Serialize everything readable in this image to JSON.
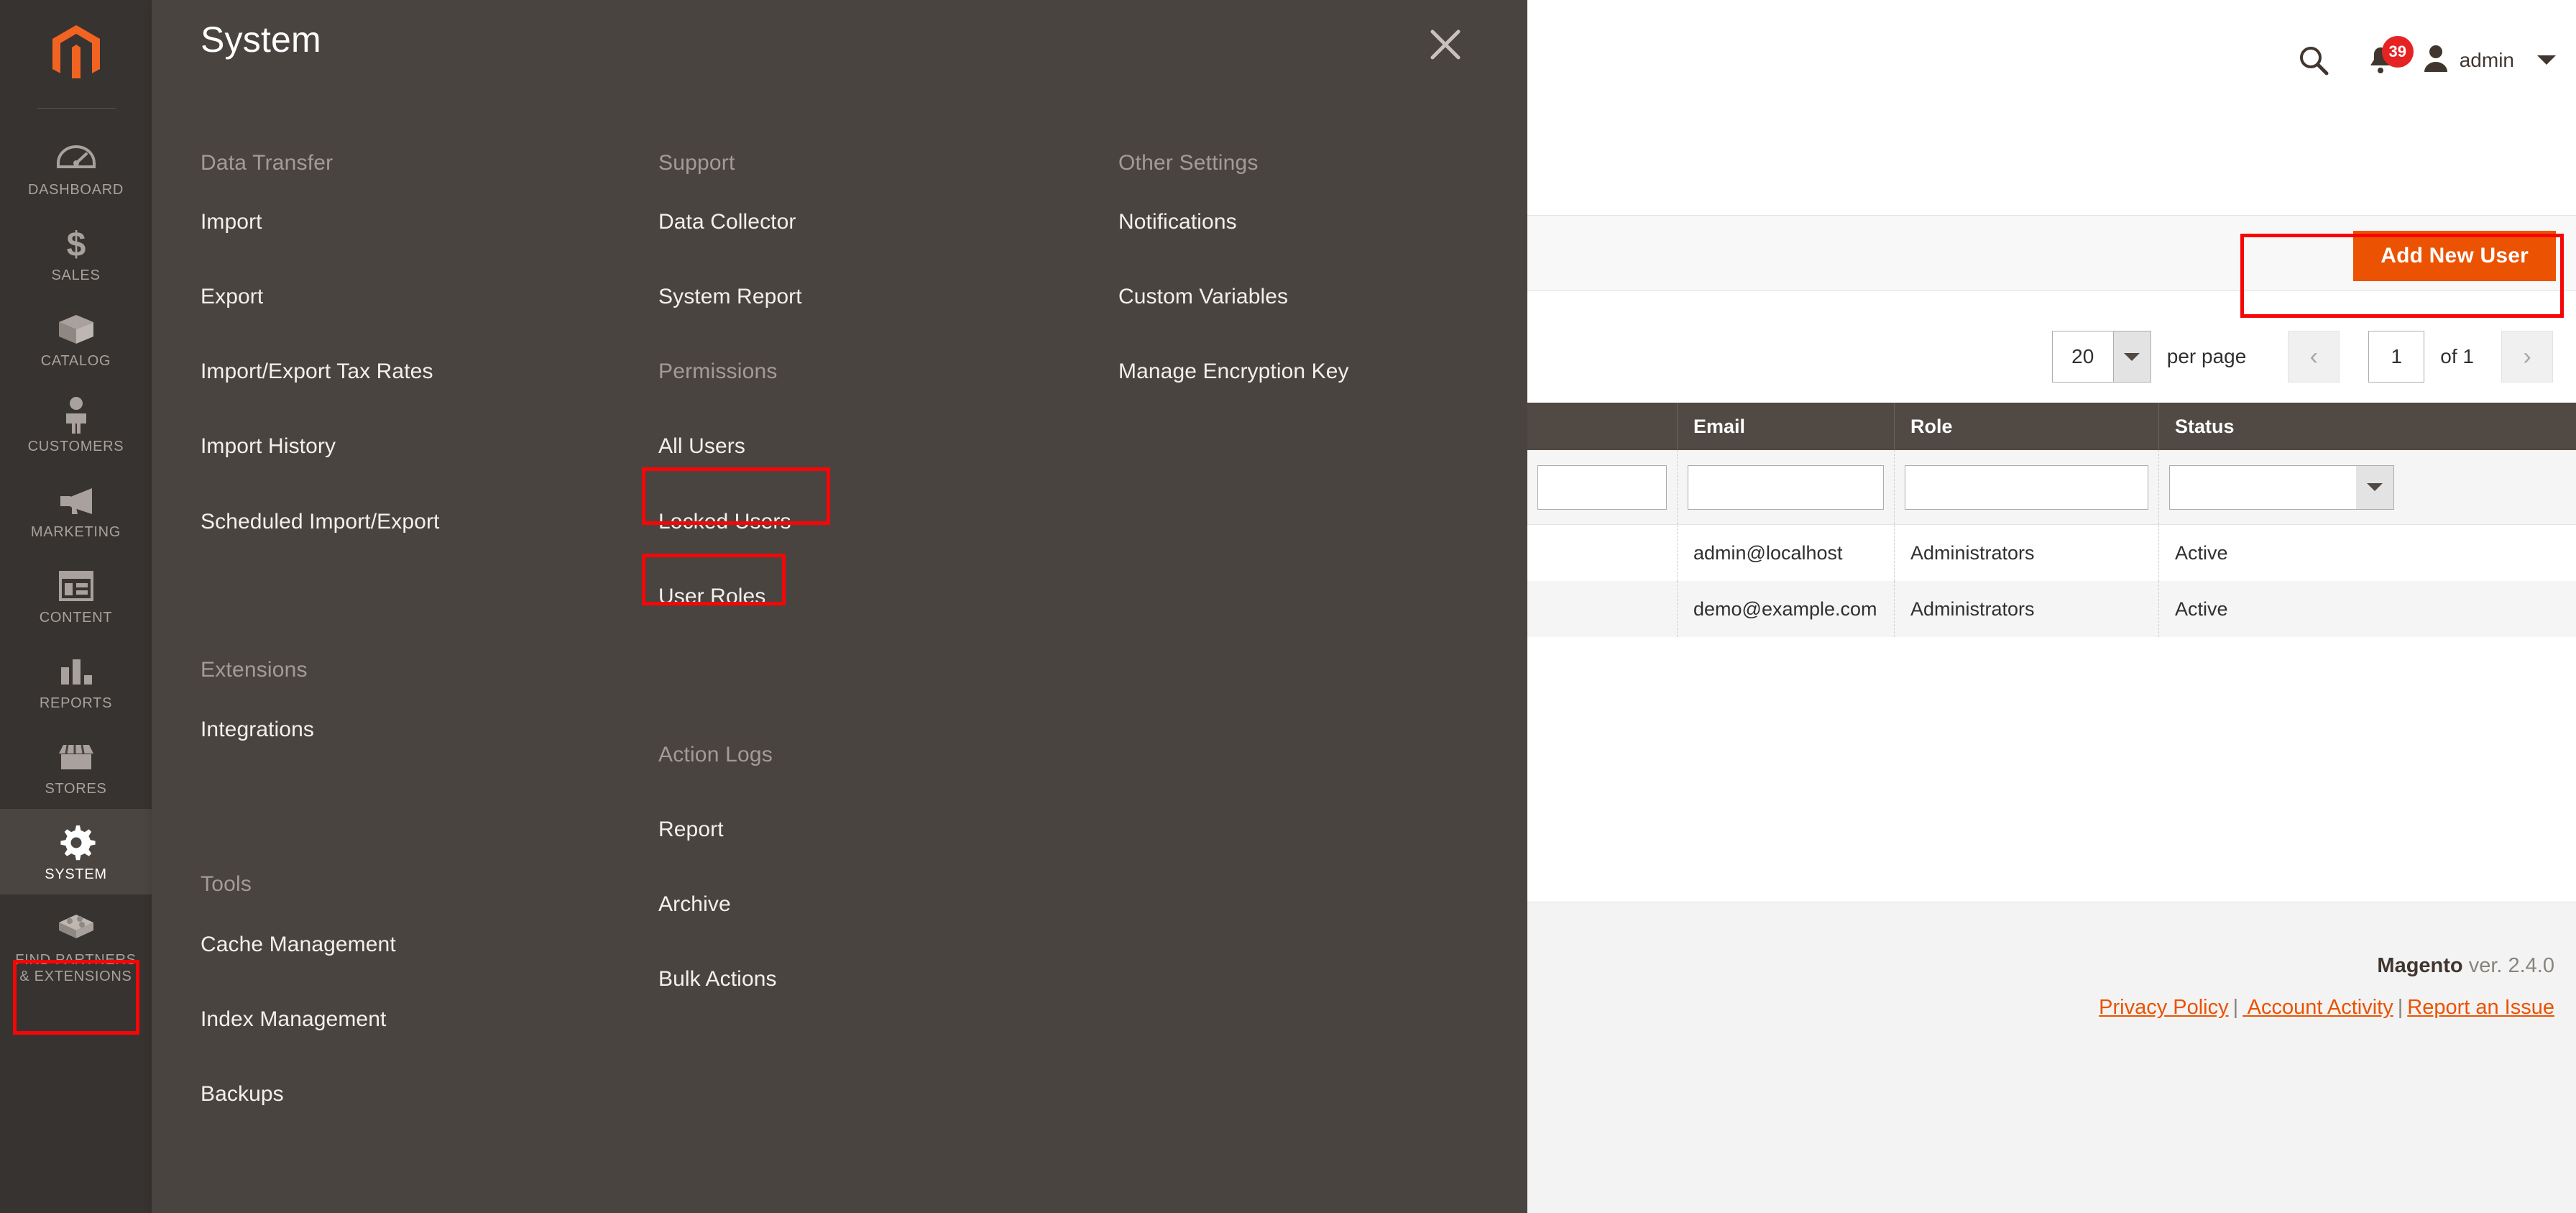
{
  "sidebar": {
    "logo_icon": "magento-logo-icon",
    "items": [
      {
        "label": "DASHBOARD",
        "icon": "dashboard-gauge-icon",
        "active": false
      },
      {
        "label": "SALES",
        "icon": "dollar-sign-icon",
        "active": false
      },
      {
        "label": "CATALOG",
        "icon": "box-package-icon",
        "active": false
      },
      {
        "label": "CUSTOMERS",
        "icon": "person-icon",
        "active": false
      },
      {
        "label": "MARKETING",
        "icon": "megaphone-icon",
        "active": false
      },
      {
        "label": "CONTENT",
        "icon": "layout-page-icon",
        "active": false
      },
      {
        "label": "REPORTS",
        "icon": "bar-chart-icon",
        "active": false
      },
      {
        "label": "STORES",
        "icon": "storefront-icon",
        "active": false
      },
      {
        "label": "SYSTEM",
        "icon": "gear-icon",
        "active": true
      },
      {
        "label": "FIND PARTNERS\n& EXTENSIONS",
        "label_line1": "FIND PARTNERS",
        "label_line2": "& EXTENSIONS",
        "icon": "puzzle-block-icon",
        "active": false
      }
    ]
  },
  "menu_panel": {
    "title": "System",
    "close_icon": "close-icon",
    "columns": [
      {
        "groups": [
          {
            "title": "Data Transfer",
            "items": [
              "Import",
              "Export",
              "Import/Export Tax Rates",
              "Import History",
              "Scheduled Import/Export"
            ]
          },
          {
            "title": "Extensions",
            "items": [
              "Integrations"
            ]
          },
          {
            "title": "Tools",
            "items": [
              "Cache Management",
              "Index Management",
              "Backups"
            ]
          }
        ]
      },
      {
        "groups": [
          {
            "title": "Support",
            "items": [
              "Data Collector",
              "System Report"
            ]
          },
          {
            "title": "Permissions",
            "items": [
              "All Users",
              "Locked Users",
              "User Roles"
            ]
          },
          {
            "title": "Action Logs",
            "items": [
              "Report",
              "Archive",
              "Bulk Actions"
            ]
          }
        ]
      },
      {
        "groups": [
          {
            "title": "Other Settings",
            "items": [
              "Notifications",
              "Custom Variables",
              "Manage Encryption Key"
            ]
          }
        ]
      }
    ]
  },
  "header": {
    "search_icon": "search-icon",
    "notifications_icon": "bell-icon",
    "notifications_count": "39",
    "user_icon": "user-avatar-icon",
    "user_name": "admin",
    "user_caret_icon": "chevron-down-icon"
  },
  "actions": {
    "add_new_user_label": "Add New User"
  },
  "pagination": {
    "per_page_value": "20",
    "per_page_label": "per page",
    "prev_icon": "chevron-left-icon",
    "next_icon": "chevron-right-icon",
    "current_page": "1",
    "of_label": "of 1"
  },
  "grid": {
    "columns": [
      "",
      "Email",
      "Role",
      "Status"
    ],
    "filters": {
      "col0": "",
      "email": "",
      "role": "",
      "status": ""
    },
    "rows": [
      {
        "col0": "",
        "email": "admin@localhost",
        "role": "Administrators",
        "status": "Active"
      },
      {
        "col0": "",
        "email": "demo@example.com",
        "role": "Administrators",
        "status": "Active"
      }
    ]
  },
  "footer": {
    "brand": "Magento",
    "version_text": " ver. 2.4.0",
    "links": [
      "Privacy Policy",
      " Account Activity",
      "Report an Issue"
    ],
    "separator": "|"
  },
  "colors": {
    "accent_orange": "#eb5202",
    "rail_dark": "#373330",
    "panel_dark": "#4a4440",
    "annotation_red": "#f60606",
    "badge_red": "#e52323"
  },
  "annotations": [
    {
      "name": "system-sidebar-highlight"
    },
    {
      "name": "permissions-highlight"
    },
    {
      "name": "all-users-highlight"
    },
    {
      "name": "add-new-user-highlight"
    }
  ]
}
